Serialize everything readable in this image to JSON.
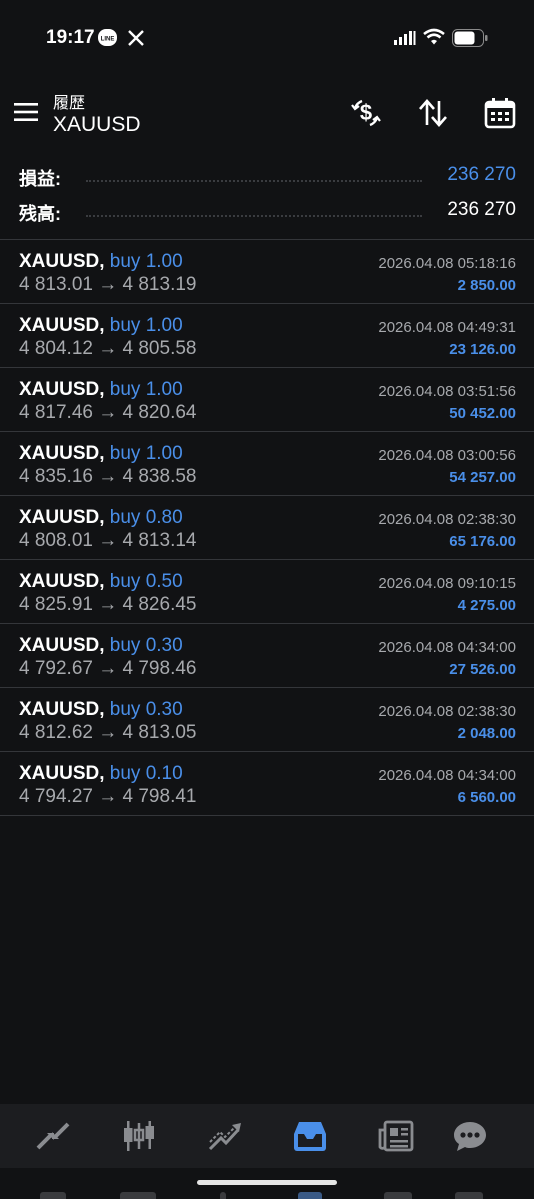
{
  "status_bar": {
    "time": "19:17"
  },
  "header": {
    "subtitle": "履歴",
    "title": "XAUUSD"
  },
  "summary": {
    "profit_label": "損益:",
    "profit_value": "236 270",
    "balance_label": "残高:",
    "balance_value": "236 270"
  },
  "deals": [
    {
      "symbol": "XAUUSD,",
      "side": "buy 1.00",
      "prices": "4 813.01 → 4 813.19",
      "time": "2026.04.08 05:18:16",
      "profit": "2 850.00"
    },
    {
      "symbol": "XAUUSD,",
      "side": "buy 1.00",
      "prices": "4 804.12 → 4 805.58",
      "time": "2026.04.08 04:49:31",
      "profit": "23 126.00"
    },
    {
      "symbol": "XAUUSD,",
      "side": "buy 1.00",
      "prices": "4 817.46 → 4 820.64",
      "time": "2026.04.08 03:51:56",
      "profit": "50 452.00"
    },
    {
      "symbol": "XAUUSD,",
      "side": "buy 1.00",
      "prices": "4 835.16 → 4 838.58",
      "time": "2026.04.08 03:00:56",
      "profit": "54 257.00"
    },
    {
      "symbol": "XAUUSD,",
      "side": "buy 0.80",
      "prices": "4 808.01 → 4 813.14",
      "time": "2026.04.08 02:38:30",
      "profit": "65 176.00"
    },
    {
      "symbol": "XAUUSD,",
      "side": "buy 0.50",
      "prices": "4 825.91 → 4 826.45",
      "time": "2026.04.08 09:10:15",
      "profit": "4 275.00"
    },
    {
      "symbol": "XAUUSD,",
      "side": "buy 0.30",
      "prices": "4 792.67 → 4 798.46",
      "time": "2026.04.08 04:34:00",
      "profit": "27 526.00"
    },
    {
      "symbol": "XAUUSD,",
      "side": "buy 0.30",
      "prices": "4 812.62 → 4 813.05",
      "time": "2026.04.08 02:38:30",
      "profit": "2 048.00"
    },
    {
      "symbol": "XAUUSD,",
      "side": "buy 0.10",
      "prices": "4 794.27 → 4 798.41",
      "time": "2026.04.08 04:34:00",
      "profit": "6 560.00"
    }
  ],
  "icons": {
    "header": [
      "currency-exchange-icon",
      "sort-icon",
      "calendar-icon"
    ],
    "nav": [
      "quotes-icon",
      "chart-icon",
      "trade-icon",
      "history-icon",
      "news-icon",
      "chat-icon"
    ]
  },
  "colors": {
    "background": "#111214",
    "accent": "#4a8fe9",
    "secondary_text": "#a7a9ad",
    "nav_background": "#1c1d20"
  },
  "active_tab": "history"
}
